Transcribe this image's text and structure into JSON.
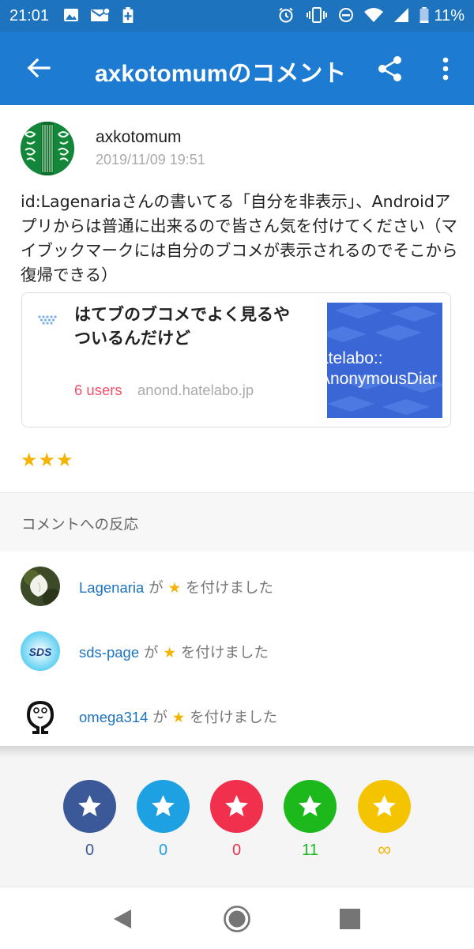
{
  "status_bar": {
    "time": "21:01",
    "battery_pct": "11%",
    "icons": [
      "image-icon",
      "mail-icon",
      "battery-saver-icon",
      "alarm-icon",
      "vibrate-icon",
      "dnd-icon",
      "wifi-icon",
      "signal-icon",
      "battery-icon"
    ]
  },
  "app_bar": {
    "title": "axkotomumのコメント",
    "back_icon": "arrow-left-icon",
    "share_icon": "share-icon",
    "more_icon": "more-vert-icon"
  },
  "comment": {
    "username": "axkotomum",
    "timestamp": "2019/11/09 19:51",
    "body": "id:Lagenariaさんの書いてる「自分を非表示」、Androidアプリからは普通に出来るので皆さん気を付けてください（マイブックマークには自分のブコメが表示されるのでそこから復帰できる）",
    "rating": "★★★"
  },
  "link_card": {
    "title": "はてブのブコメでよく見るやついるんだけど",
    "users": "6 users",
    "domain": "anond.hatelabo.jp",
    "thumbnail_text_line1": "atelabo::",
    "thumbnail_text_line2": "AnonymousDiar"
  },
  "reactions": {
    "header": "コメントへの反応",
    "items": [
      {
        "name": "Lagenaria",
        "ga": " が ",
        "star": "★",
        "suffix": " を付けました"
      },
      {
        "name": "sds-page",
        "ga": " が ",
        "star": "★",
        "suffix": " を付けました"
      },
      {
        "name": "omega314",
        "ga": " が ",
        "star": "★",
        "suffix": " を付けました"
      }
    ],
    "sds_avatar_text": "SDS"
  },
  "star_bar": {
    "buttons": [
      {
        "count": "0",
        "color": "#3b5998",
        "count_color": "#3b5998"
      },
      {
        "count": "0",
        "color": "#1da1e2",
        "count_color": "#1da1e2"
      },
      {
        "count": "0",
        "color": "#f0304c",
        "count_color": "#f0304c"
      },
      {
        "count": "11",
        "color": "#1cb81c",
        "count_color": "#1cb81c"
      },
      {
        "count": "∞",
        "color": "#f5c400",
        "count_color": "#f5b400"
      }
    ]
  },
  "nav_bar": {
    "icons": [
      "nav-back-icon",
      "nav-home-icon",
      "nav-recents-icon"
    ]
  },
  "colors": {
    "app_bar": "#1e7bd2",
    "status_bar": "#1e73be",
    "link": "#1e73be",
    "users_count": "#f2506a",
    "star": "#f5b400"
  }
}
